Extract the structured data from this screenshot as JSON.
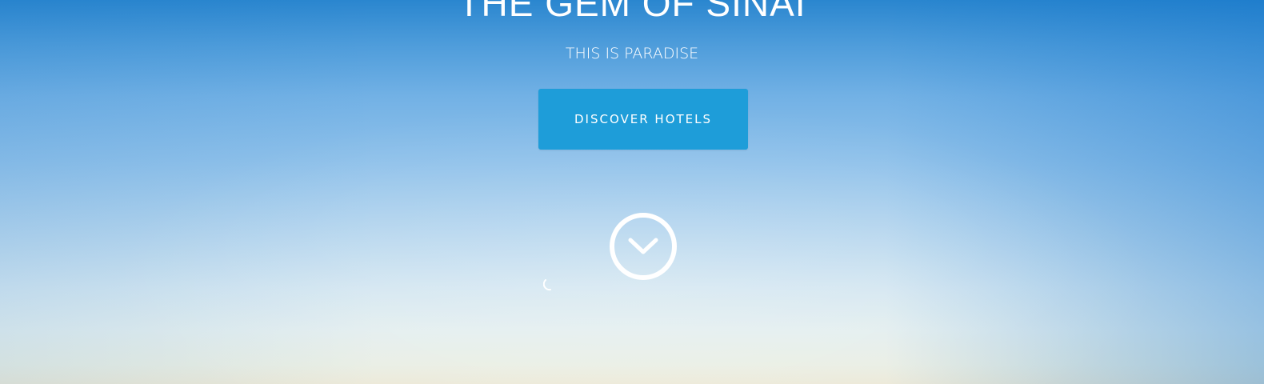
{
  "hero": {
    "title": "THE GEM OF SINAI",
    "subtitle": "THIS IS PARADISE",
    "cta_label": "DISCOVER HOTELS",
    "scroll_icon": "chevron-down-circle-icon",
    "loader_icon": "spinner-icon"
  },
  "colors": {
    "button": "#1e9dd9",
    "text": "#ffffff",
    "sky_top": "#2a86cf",
    "sky_bottom": "#ece9d8"
  }
}
